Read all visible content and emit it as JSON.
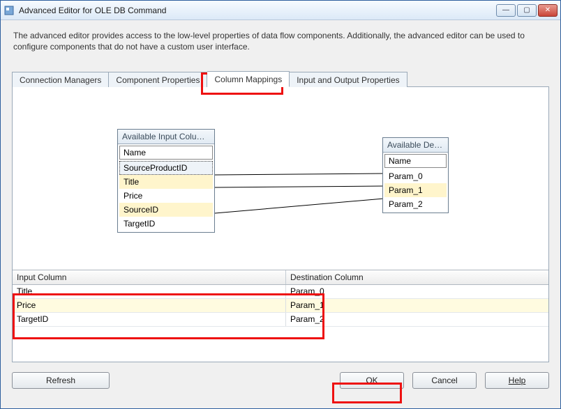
{
  "window": {
    "title": "Advanced Editor for OLE DB Command",
    "description": "The advanced editor provides access to the low-level properties of data flow components. Additionally, the advanced editor can be used to configure components that do not have a custom user interface."
  },
  "tabs": [
    {
      "label": "Connection Managers",
      "active": false
    },
    {
      "label": "Component Properties",
      "active": false
    },
    {
      "label": "Column Mappings",
      "active": true
    },
    {
      "label": "Input and Output Properties",
      "active": false
    }
  ],
  "input_panel": {
    "title": "Available Input Colu…",
    "col_header": "Name",
    "items": [
      {
        "label": "SourceProductID",
        "selected": true,
        "highlight": false
      },
      {
        "label": "Title",
        "selected": false,
        "highlight": true
      },
      {
        "label": "Price",
        "selected": false,
        "highlight": false
      },
      {
        "label": "SourceID",
        "selected": false,
        "highlight": true
      },
      {
        "label": "TargetID",
        "selected": false,
        "highlight": false
      }
    ]
  },
  "dest_panel": {
    "title": "Available De…",
    "col_header": "Name",
    "items": [
      {
        "label": "Param_0",
        "selected": false,
        "highlight": false
      },
      {
        "label": "Param_1",
        "selected": false,
        "highlight": true
      },
      {
        "label": "Param_2",
        "selected": false,
        "highlight": false
      }
    ]
  },
  "grid": {
    "headers": {
      "input": "Input Column",
      "dest": "Destination Column"
    },
    "rows": [
      {
        "input": "Title",
        "dest": "Param_0"
      },
      {
        "input": "Price",
        "dest": "Param_1"
      },
      {
        "input": "TargetID",
        "dest": "Param_2"
      }
    ]
  },
  "buttons": {
    "refresh": "Refresh",
    "ok": "OK",
    "cancel": "Cancel",
    "help": "Help"
  },
  "winbuttons": {
    "min": "—",
    "max": "▢",
    "close": "✕"
  },
  "highlights": {
    "tab_column_mappings": true,
    "grid_rows": true,
    "ok_button": true
  }
}
